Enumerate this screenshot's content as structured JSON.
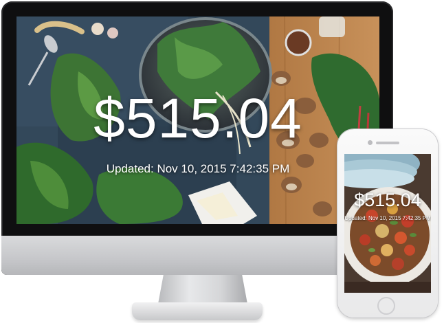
{
  "desktop": {
    "price": "$515.04",
    "updated": "Updated: Nov 10, 2015 7:42:35 PM"
  },
  "mobile": {
    "price": "$515.04",
    "updated": "Updated: Nov 10, 2015 7:42:35 PM"
  },
  "colors": {
    "text": "#ffffff",
    "monitor_bezel": "#0f0f10",
    "device_silver": "#c6c7ca"
  }
}
